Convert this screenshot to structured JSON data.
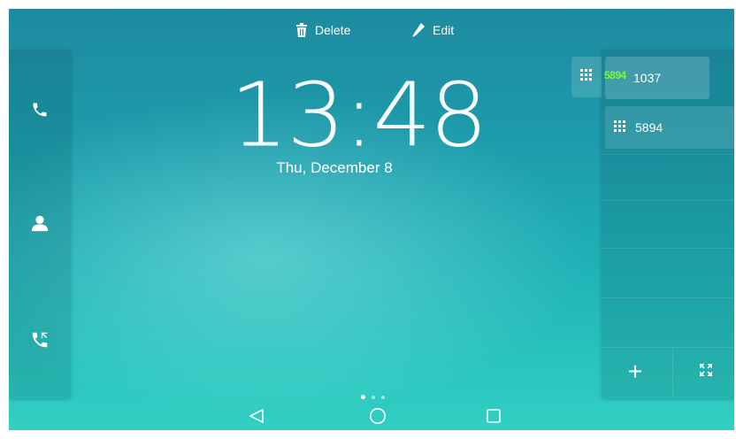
{
  "top_actions": {
    "delete_label": "Delete",
    "edit_label": "Edit"
  },
  "clock": {
    "time": "13:48",
    "date": "Thu, December 8"
  },
  "left_dock": {
    "items": [
      {
        "name": "phone",
        "icon": "phone-icon"
      },
      {
        "name": "contacts",
        "icon": "contact-icon"
      },
      {
        "name": "call-history",
        "icon": "call-history-icon"
      }
    ]
  },
  "dsskeys": {
    "keys": [
      {
        "label": "1037",
        "icon": "keypad-icon"
      },
      {
        "label": "5894",
        "icon": "keypad-icon"
      }
    ],
    "drag_overlap_label": "5894",
    "add_label": "+"
  },
  "pager": {
    "pages": 3,
    "active": 1
  },
  "navigation": {
    "back_icon": "back-triangle-icon",
    "home_icon": "home-circle-icon",
    "recent_icon": "recent-square-icon"
  },
  "colors": {
    "background_top": "#1e8a9f",
    "background_bottom": "#32d0c4",
    "overlap_label": "#7bff38",
    "text": "#ffffff"
  }
}
